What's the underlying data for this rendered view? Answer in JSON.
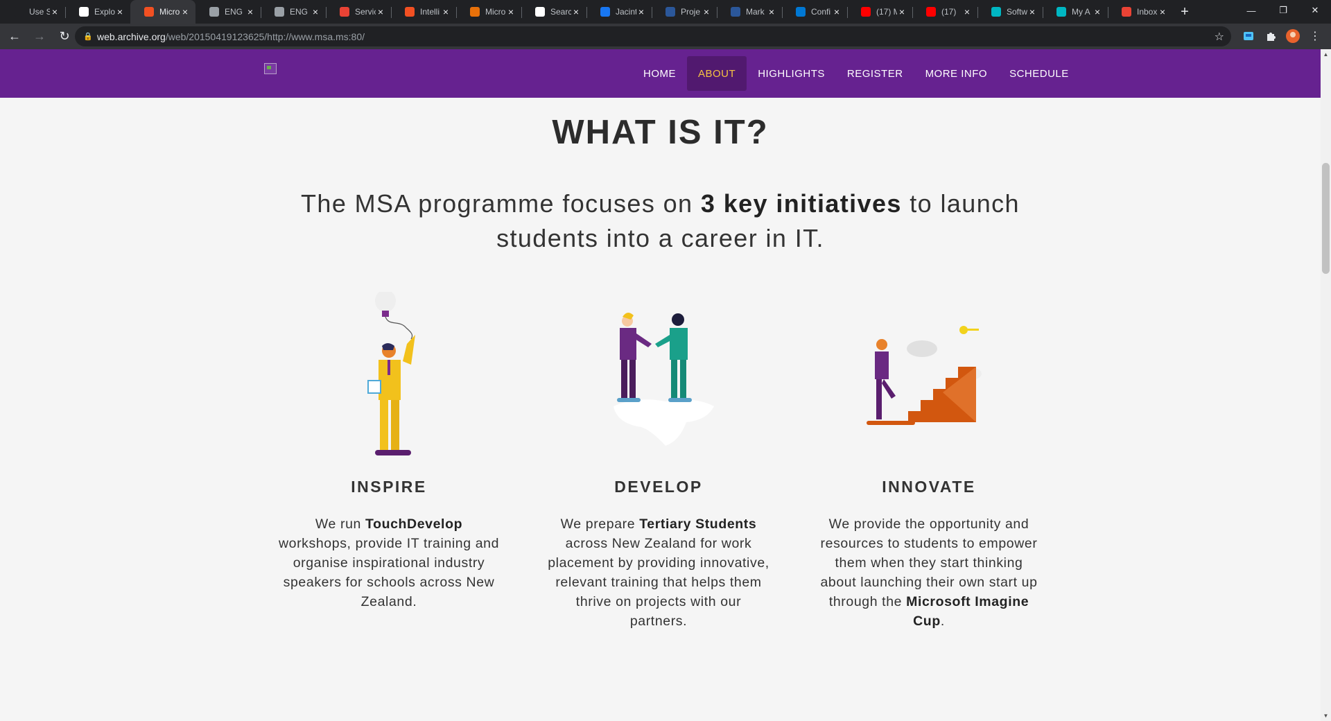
{
  "browser": {
    "tabs": [
      {
        "title": "Use S",
        "icon": "github-icon",
        "color": "#202124"
      },
      {
        "title": "Explo",
        "icon": "cloud-icon",
        "color": "#ffffff"
      },
      {
        "title": "Micro",
        "icon": "microsoft-icon",
        "color": "#f25022",
        "active": true
      },
      {
        "title": "ENG",
        "icon": "globe-icon",
        "color": "#9aa0a6"
      },
      {
        "title": "ENG",
        "icon": "globe-icon",
        "color": "#9aa0a6"
      },
      {
        "title": "Servic",
        "icon": "gmail-icon",
        "color": "#ea4335"
      },
      {
        "title": "Intelli",
        "icon": "microsoft-icon",
        "color": "#f25022"
      },
      {
        "title": "Micro",
        "icon": "oz-icon",
        "color": "#e8710a"
      },
      {
        "title": "Searc",
        "icon": "wikipedia-icon",
        "color": "#ffffff"
      },
      {
        "title": "Jacint",
        "icon": "facebook-icon",
        "color": "#1877f2"
      },
      {
        "title": "Proje",
        "icon": "word-icon",
        "color": "#2b579a"
      },
      {
        "title": "Mark",
        "icon": "word-icon",
        "color": "#2b579a"
      },
      {
        "title": "Confi",
        "icon": "vscode-icon",
        "color": "#0078d4"
      },
      {
        "title": "(17) M",
        "icon": "youtube-icon",
        "color": "#ff0000"
      },
      {
        "title": "(17)",
        "icon": "youtube-icon",
        "color": "#ff0000"
      },
      {
        "title": "Softw",
        "icon": "circle-icon",
        "color": "#00b7c3"
      },
      {
        "title": "My A",
        "icon": "circle-icon",
        "color": "#00b7c3"
      },
      {
        "title": "Inbox",
        "icon": "gmail-icon",
        "color": "#ea4335"
      }
    ],
    "url_host": "web.archive.org",
    "url_path": "/web/20150419123625/http://www.msa.ms:80/"
  },
  "nav": {
    "items": [
      "HOME",
      "ABOUT",
      "HIGHLIGHTS",
      "REGISTER",
      "MORE INFO",
      "SCHEDULE"
    ],
    "active": "ABOUT",
    "background": "#662290",
    "active_color": "#f6c343"
  },
  "main": {
    "heading": "WHAT IS IT?",
    "lead_prefix": "The MSA programme focuses on ",
    "lead_bold": "3 key initiatives",
    "lead_suffix": " to launch students into a career in IT."
  },
  "columns": [
    {
      "title": "INSPIRE",
      "t1": "We run ",
      "b1": "TouchDevelop",
      "t2": " workshops, provide IT training and organise inspirational industry speakers for schools across New Zealand.",
      "b2": "",
      "t3": ""
    },
    {
      "title": "DEVELOP",
      "t1": "We prepare ",
      "b1": "Tertiary Students",
      "t2": " across New Zealand for work placement by providing innovative, relevant training that helps them thrive on projects with our partners.",
      "b2": "",
      "t3": ""
    },
    {
      "title": "INNOVATE",
      "t1": "We provide the opportunity and resources to students to empower them when they start thinking about launching their own start up through the ",
      "b1": "",
      "t2": "",
      "b2": "Microsoft Imagine Cup",
      "t3": "."
    }
  ]
}
